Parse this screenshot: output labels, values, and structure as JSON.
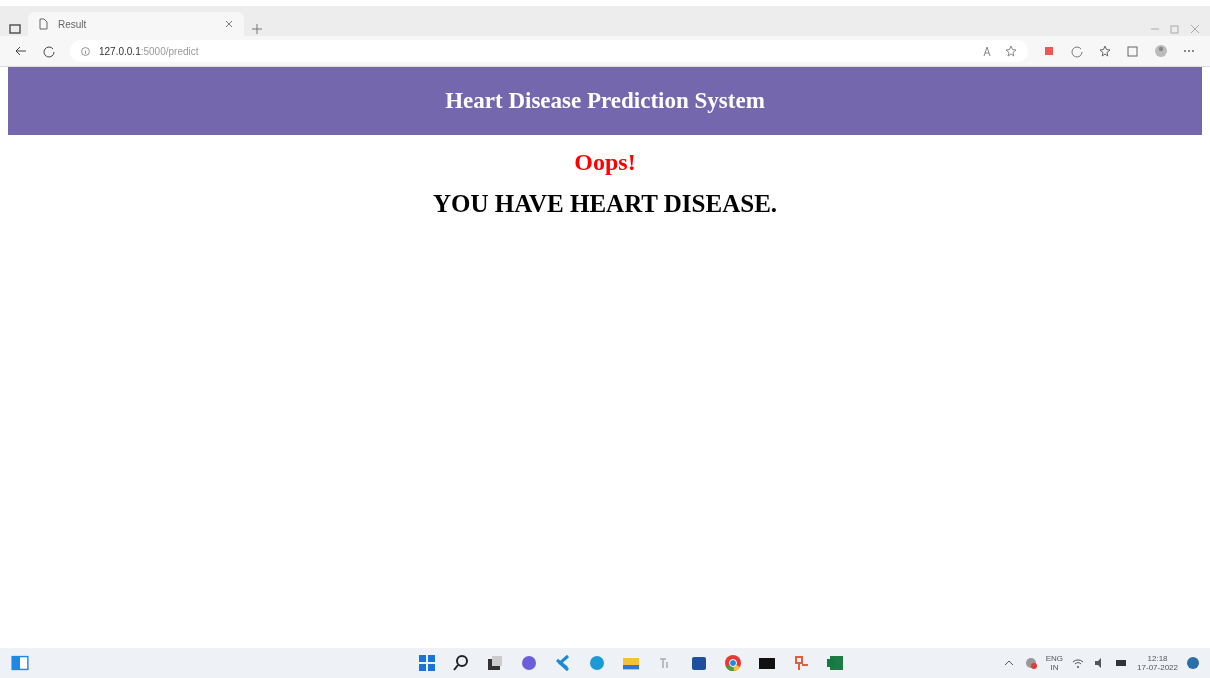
{
  "browser": {
    "tabs": [
      {
        "title": "Result",
        "selected": true
      }
    ],
    "url_host": "127.0.0.1",
    "url_path": ":5000/predict"
  },
  "header": {
    "title": "Heart Disease Prediction System"
  },
  "result": {
    "headline": "Oops!",
    "message": "YOU HAVE HEART DISEASE."
  },
  "taskbar": {
    "language": "ENG",
    "region": "IN",
    "time": "12:18",
    "date": "17-07-2022"
  }
}
